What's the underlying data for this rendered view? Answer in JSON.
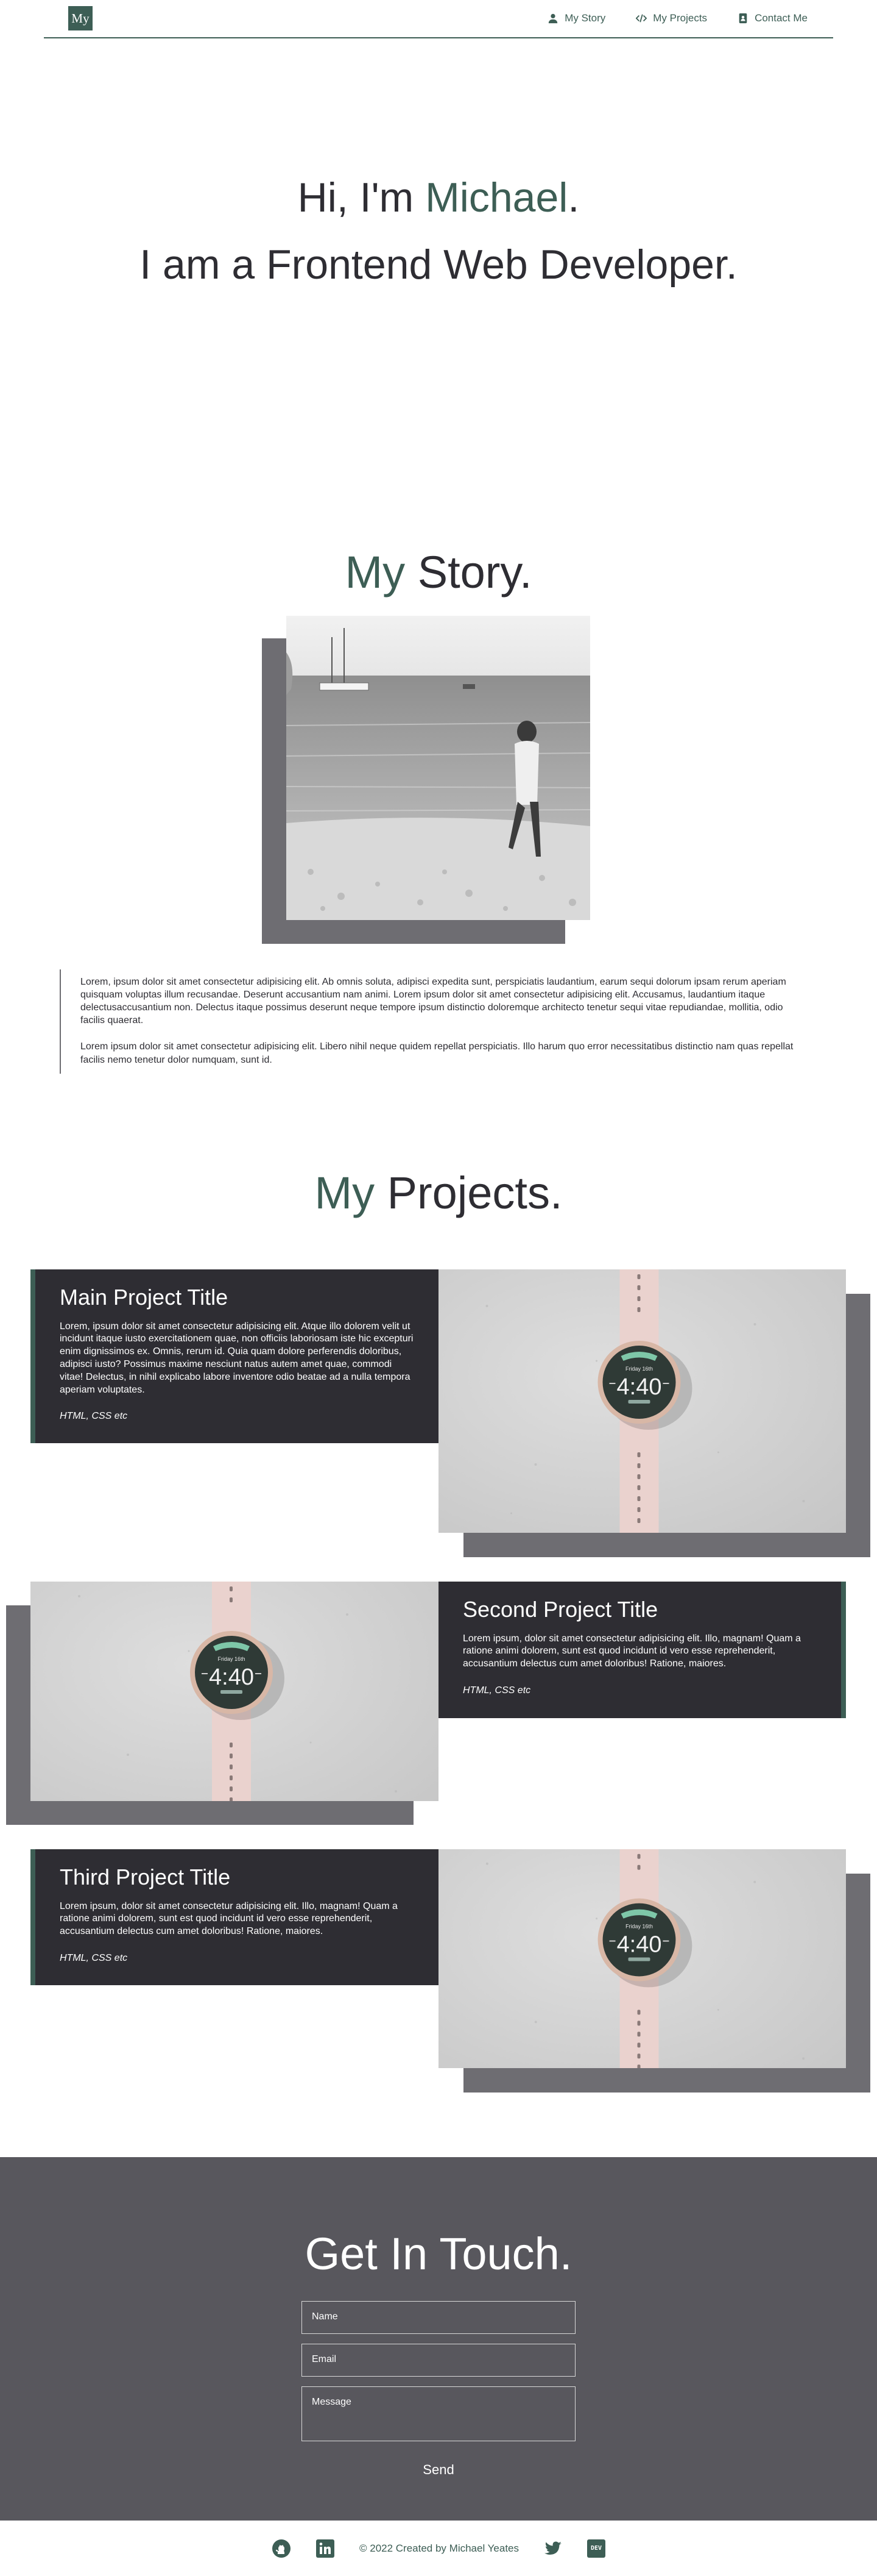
{
  "nav": {
    "logo": "My",
    "links": [
      {
        "label": "My Story",
        "icon": "user-icon"
      },
      {
        "label": "My Projects",
        "icon": "code-icon"
      },
      {
        "label": "Contact Me",
        "icon": "contact-book-icon"
      }
    ]
  },
  "hero": {
    "greeting_prefix": "Hi, I'm ",
    "name": "Michael",
    "greeting_suffix": ".",
    "subtitle": "I am a Frontend Web Developer."
  },
  "story": {
    "title_accent": "My",
    "title_rest": " Story.",
    "paragraphs": [
      "Lorem, ipsum dolor sit amet consectetur adipisicing elit. Ab omnis soluta, adipisci expedita sunt, perspiciatis laudantium, earum sequi dolorum ipsam rerum aperiam quisquam voluptas illum recusandae. Deserunt accusantium nam animi. Lorem ipsum dolor sit amet consectetur adipisicing elit. Accusamus, laudantium itaque delectusaccusantium non. Delectus itaque possimus deserunt neque tempore ipsum distinctio doloremque architecto tenetur sequi vitae repudiandae, mollitia, odio facilis quaerat.",
      "Lorem ipsum dolor sit amet consectetur adipisicing elit. Libero nihil neque quidem repellat perspiciatis. Illo harum quo error necessitatibus distinctio nam quas repellat facilis nemo tenetur dolor numquam, sunt id."
    ]
  },
  "projects": {
    "title_accent": "My",
    "title_rest": " Projects.",
    "items": [
      {
        "title": "Main Project Title",
        "description": "Lorem, ipsum dolor sit amet consectetur adipisicing elit. Atque illo dolorem velit ut incidunt itaque iusto exercitationem quae, non officiis laboriosam iste hic excepturi enim dignissimos ex. Omnis, rerum id. Quia quam dolore perferendis doloribus, adipisci iusto? Possimus maxime nesciunt natus autem amet quae, commodi vitae! Delectus, in nihil explicabo labore inventore odio beatae ad a nulla tempora aperiam voluptates.",
        "tech": "HTML, CSS etc"
      },
      {
        "title": "Second Project Title",
        "description": "Lorem ipsum, dolor sit amet consectetur adipisicing elit. Illo, magnam! Quam a ratione animi dolorem, sunt est quod incidunt id vero esse reprehenderit, accusantium delectus cum amet doloribus! Ratione, maiores.",
        "tech": "HTML, CSS etc"
      },
      {
        "title": "Third Project Title",
        "description": "Lorem ipsum, dolor sit amet consectetur adipisicing elit. Illo, magnam! Quam a ratione animi dolorem, sunt est quod incidunt id vero esse reprehenderit, accusantium delectus cum amet doloribus! Ratione, maiores.",
        "tech": "HTML, CSS etc"
      }
    ],
    "watch": {
      "day": "Friday 16th",
      "time": "4:40"
    }
  },
  "contact": {
    "title": "Get In Touch.",
    "name_placeholder": "Name",
    "email_placeholder": "Email",
    "message_placeholder": "Message",
    "send_label": "Send"
  },
  "footer": {
    "copyright": "© 2022 Created by Michael Yeates",
    "icons": [
      "github-icon",
      "linkedin-icon",
      "twitter-icon",
      "dev-icon"
    ],
    "dev_badge": "DEV"
  },
  "colors": {
    "accent": "#3d5e55",
    "dark": "#2e2d33",
    "shadow": "#6e6d72",
    "contact_bg": "#58575d"
  }
}
